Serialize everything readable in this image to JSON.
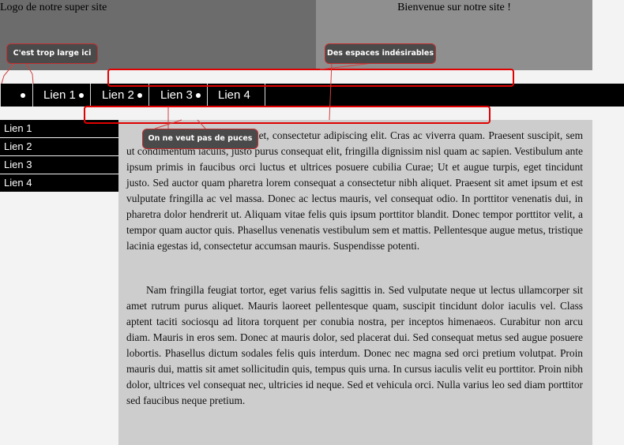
{
  "header": {
    "logo": "Logo de notre super site",
    "welcome": "Bienvenue sur notre site !"
  },
  "topnav": {
    "items": [
      "Lien 1",
      "Lien 2",
      "Lien 3",
      "Lien 4"
    ]
  },
  "sidebar": {
    "items": [
      "Lien 1",
      "Lien 2",
      "Lien 3",
      "Lien 4"
    ]
  },
  "content": {
    "paragraphs": [
      "Lorem ipsum dolor sit amet, consectetur adipiscing elit. Cras ac viverra quam. Praesent suscipit, sem ut condimentum iaculis, justo purus consequat elit, fringilla dignissim nisl quam ac sapien. Vestibulum ante ipsum primis in faucibus orci luctus et ultrices posuere cubilia Curae; Ut et augue turpis, eget tincidunt justo. Sed auctor quam pharetra lorem consequat a consectetur nibh aliquet. Praesent sit amet ipsum et est vulputate fringilla ac vel massa. Donec ac lectus mauris, vel consequat odio. In porttitor venenatis dui, in pharetra dolor hendrerit ut. Aliquam vitae felis quis ipsum porttitor blandit. Donec tempor porttitor velit, a tempor quam auctor quis. Phasellus venenatis vestibulum sem et mattis. Pellentesque augue metus, tristique lacinia egestas id, consectetur accumsan mauris. Suspendisse potenti.",
      "Nam fringilla feugiat tortor, eget varius felis sagittis in. Sed vulputate neque ut lectus ullamcorper sit amet rutrum purus aliquet. Mauris laoreet pellentesque quam, suscipit tincidunt dolor iaculis vel. Class aptent taciti sociosqu ad litora torquent per conubia nostra, per inceptos himenaeos. Curabitur non arcu diam. Mauris in eros sem. Donec at mauris dolor, sed placerat dui. Sed consequat metus sed augue posuere lobortis. Phasellus dictum sodales felis quis interdum. Donec nec magna sed orci pretium volutpat. Proin mauris dui, mattis sit amet sollicitudin quis, tempus quis urna. In cursus iaculis velit eu porttitor. Proin nibh dolor, ultrices vel consequat nec, ultricies id neque. Sed et vehicula orci. Nulla varius leo sed diam porttitor sed faucibus neque pretium."
    ]
  },
  "annotations": {
    "too_wide": "C'est trop large ici",
    "unwanted_spaces": "Des espaces indésirables",
    "no_bullets": "On ne veut pas de puces"
  },
  "colors": {
    "annotation_red": "#e00000",
    "nav_bg": "#000000"
  }
}
